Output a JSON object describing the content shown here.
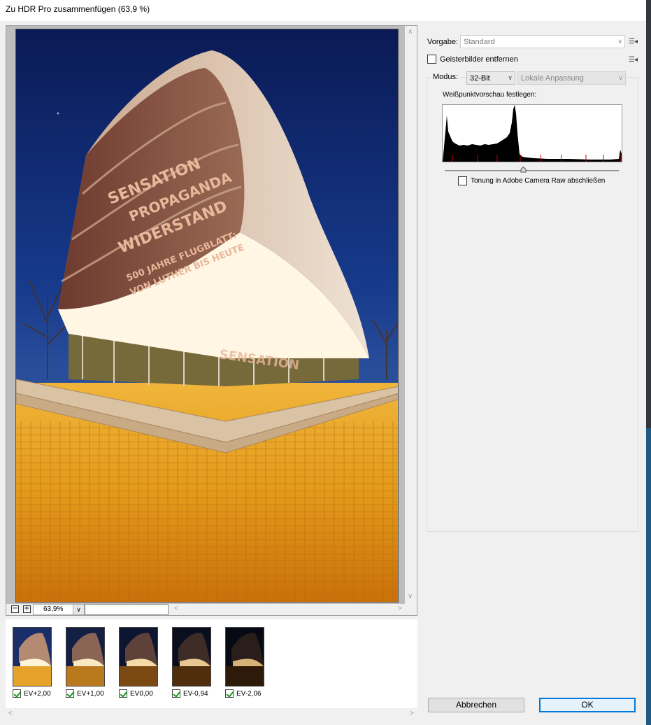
{
  "window": {
    "title": "Zu HDR Pro zusammenfügen (63,9 %)"
  },
  "preview": {
    "zoom_value": "63,9%",
    "zoom_out": "−",
    "zoom_in": "+",
    "scroll_up": "∨",
    "scroll_down": "∨",
    "scroll_left": "<",
    "scroll_right": ">"
  },
  "sources": [
    {
      "label": "EV+2,00",
      "checked": true
    },
    {
      "label": "EV+1,00",
      "checked": true
    },
    {
      "label": "EV0,00",
      "checked": true
    },
    {
      "label": "EV-0,94",
      "checked": true
    },
    {
      "label": "EV-2,06",
      "checked": true
    }
  ],
  "settings": {
    "vorgabe_label": "Vorgabe:",
    "vorgabe_value": "Standard",
    "ghost_label": "Geisterbilder entfernen",
    "ghost_checked": false,
    "modus_label": "Modus:",
    "modus_value": "32-Bit",
    "method_value": "Lokale Anpassung",
    "whitepoint_label": "Weißpunktvorschau festlegen:",
    "whitepoint_level": 0.45,
    "acr_label": "Tonung in Adobe Camera Raw abschließen",
    "acr_checked": false
  },
  "buttons": {
    "cancel": "Abbrechen",
    "ok": "OK"
  },
  "icons": {
    "menu": "flyout-menu-icon",
    "dropdown": "chevron-down-icon"
  }
}
